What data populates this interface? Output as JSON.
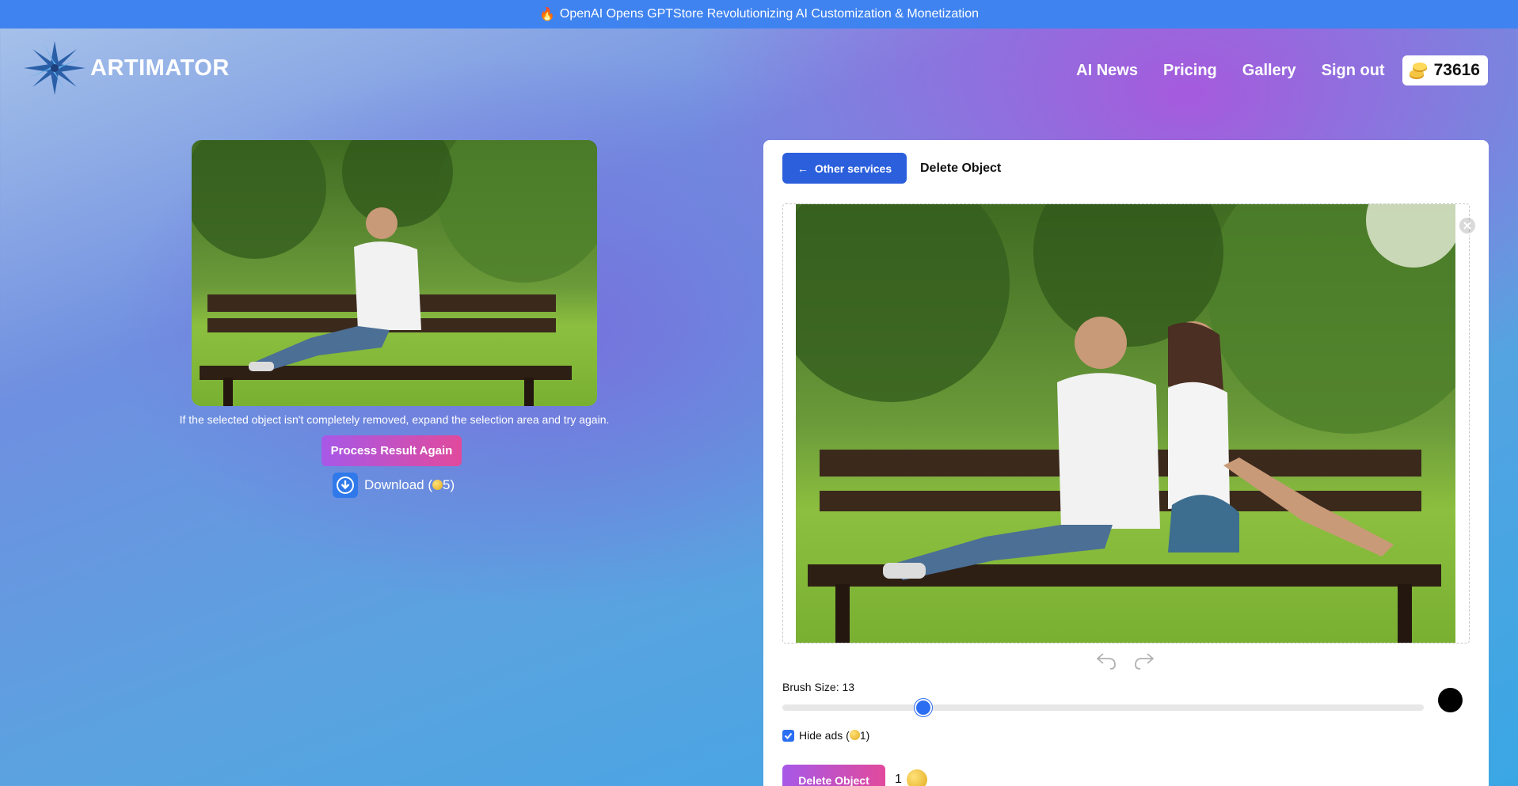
{
  "banner": {
    "icon": "flame-icon",
    "text": "OpenAI Opens GPTStore Revolutionizing AI Customization & Monetization"
  },
  "header": {
    "logo_text": "ARTIMATOR",
    "nav": [
      "AI News",
      "Pricing",
      "Gallery",
      "Sign out"
    ],
    "coins": "73616"
  },
  "result": {
    "hint": "If the selected object isn't completely removed, expand the selection area and try again.",
    "process_label": "Process Result Again",
    "download_prefix": "Download (",
    "download_cost": "5",
    "download_suffix": ")"
  },
  "editor": {
    "back_label": "Other services",
    "title": "Delete Object",
    "brush_label": "Brush Size: 13",
    "brush_fraction": 0.22,
    "hide_ads_prefix": "Hide ads (",
    "hide_ads_cost": "1",
    "hide_ads_suffix": ")",
    "hide_ads_checked": true,
    "delete_label": "Delete Object",
    "delete_cost": "1"
  },
  "colors": {
    "banner": "#3f83f0",
    "primary": "#2b5fdc",
    "gradient_start": "#a758e8",
    "gradient_end": "#e14a9c"
  }
}
